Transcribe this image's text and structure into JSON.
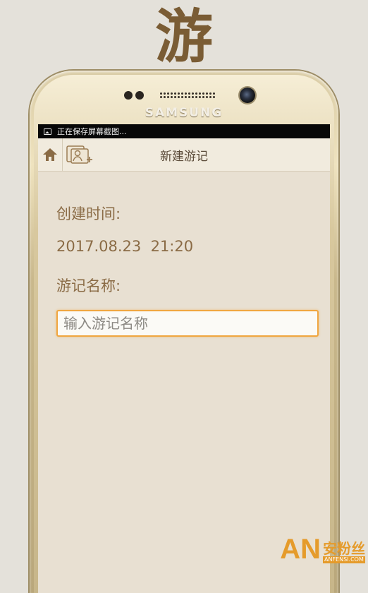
{
  "banner": {
    "char": "游"
  },
  "phone": {
    "brand": "SAMSUNG"
  },
  "statusbar": {
    "text": "正在保存屏幕截图..."
  },
  "navbar": {
    "title": "新建游记",
    "home_icon": "home-icon",
    "add_icon": "add-people-icon"
  },
  "form": {
    "time_label": "创建时间:",
    "time_value": "2017.08.23  21:20",
    "name_label": "游记名称:",
    "name_placeholder": "输入游记名称",
    "name_value": ""
  },
  "watermark": {
    "mark": "AN",
    "cn": "安粉丝",
    "url": "ANFENSI.COM"
  },
  "colors": {
    "accent": "#8a6b45",
    "input_border": "#f0a640",
    "screen_bg": "#e8e0d2",
    "nav_bg": "#f1ebde"
  }
}
